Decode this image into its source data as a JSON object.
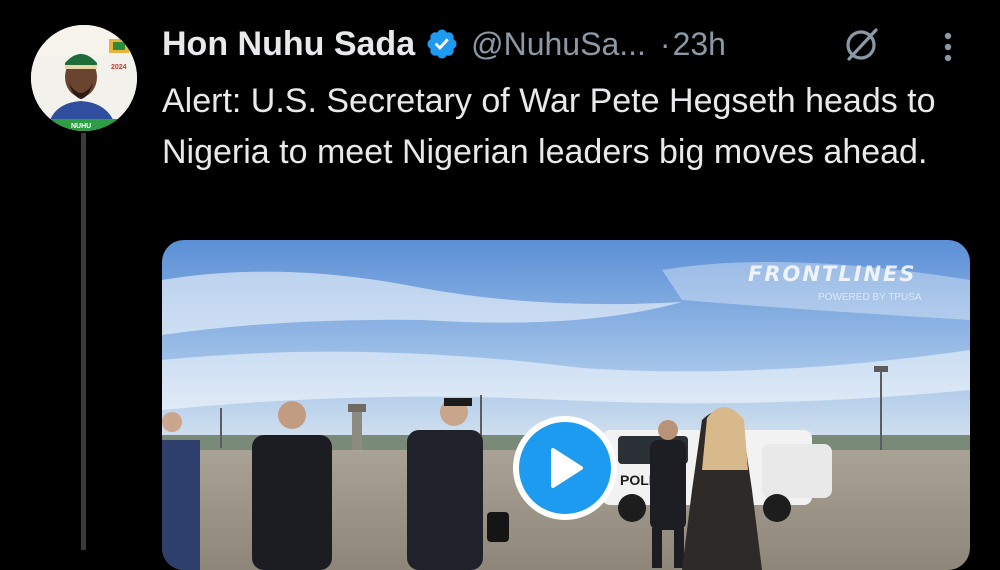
{
  "tweet": {
    "display_name": "Hon Nuhu Sada",
    "handle": "@NuhuSa...",
    "separator": "·",
    "time": "23h",
    "text": "Alert: U.S. Secretary of War Pete Hegseth heads to Nigeria to meet Nigerian leaders big moves ahead.",
    "avatar": {
      "badge_year": "2024",
      "shirt_text": "NUHU"
    },
    "media": {
      "type": "video",
      "watermark": "FRONTLINES",
      "watermark_sub": "POWERED BY TPUSA",
      "vehicle_text": "POLI"
    }
  },
  "icons": {
    "verified": "verified-badge-icon",
    "grok": "grok-icon",
    "more": "more-vertical-icon",
    "play": "play-icon"
  },
  "colors": {
    "background": "#000000",
    "primary_text": "#e7e9ea",
    "secondary_text": "#8b98a5",
    "accent": "#1d9bf0"
  }
}
